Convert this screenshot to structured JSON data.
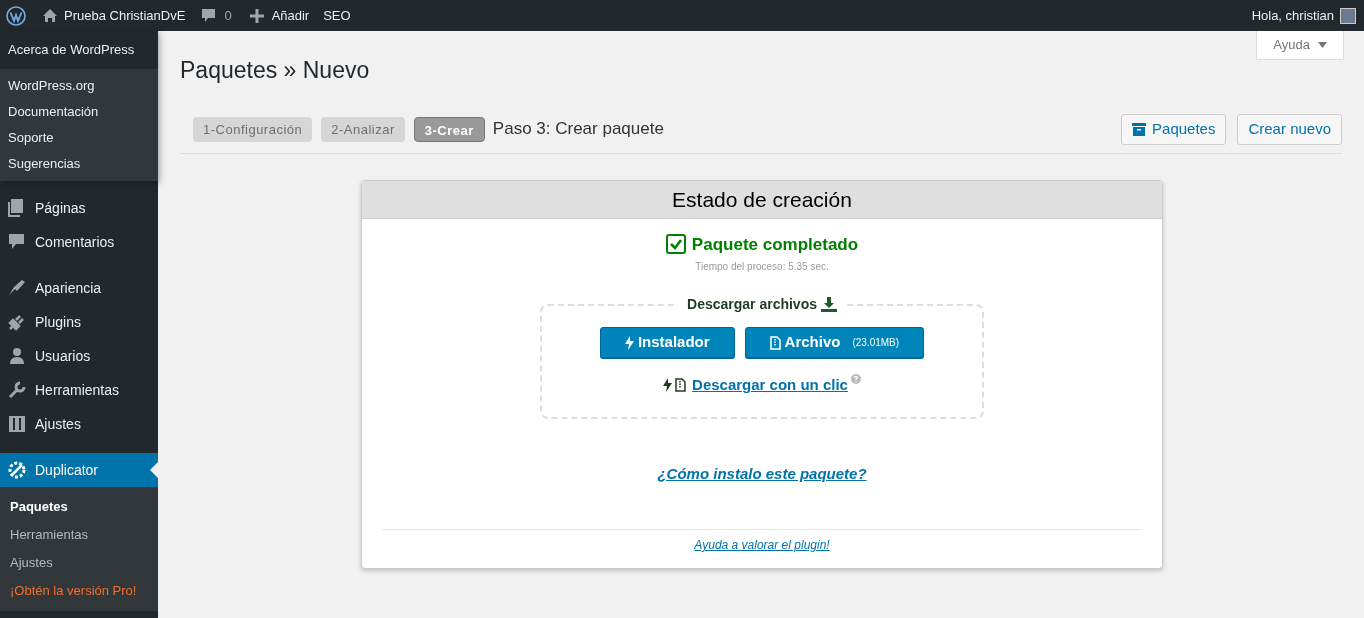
{
  "admin_bar": {
    "site": "Prueba ChristianDvE",
    "comments": "0",
    "add": "Añadir",
    "seo": "SEO",
    "greeting": "Hola, christian"
  },
  "wp_menu": {
    "about": "Acerca de WordPress",
    "links": [
      "WordPress.org",
      "Documentación",
      "Soporte",
      "Sugerencias"
    ]
  },
  "sidebar": {
    "groups": [
      {
        "items": [
          {
            "label": "Páginas",
            "selected": false
          },
          {
            "label": "Comentarios",
            "selected": false
          }
        ]
      },
      {
        "items": [
          {
            "label": "Apariencia",
            "selected": false
          },
          {
            "label": "Plugins",
            "selected": false
          },
          {
            "label": "Usuarios",
            "selected": false
          },
          {
            "label": "Herramientas",
            "selected": false
          },
          {
            "label": "Ajustes",
            "selected": false
          }
        ]
      },
      {
        "items": [
          {
            "label": "Duplicator",
            "selected": true,
            "children": [
              {
                "label": "Paquetes",
                "selected": true,
                "kind": "link"
              },
              {
                "label": "Herramientas",
                "selected": false,
                "kind": "link"
              },
              {
                "label": "Ajustes",
                "selected": false,
                "kind": "link"
              },
              {
                "label": "¡Obtén la versión Pro!",
                "selected": false,
                "kind": "promo"
              }
            ]
          }
        ]
      }
    ]
  },
  "help_button": "Ayuda",
  "page_title": "Paquetes » Nuevo",
  "steps": [
    {
      "label": "1-Configuración",
      "selected": false
    },
    {
      "label": "2-Analizar",
      "selected": false
    },
    {
      "label": "3-Crear",
      "selected": true
    }
  ],
  "step_caption": "Paso 3: Crear paquete",
  "header_buttons": [
    {
      "label": "Paquetes",
      "kind": "icon"
    },
    {
      "label": "Crear nuevo",
      "kind": "plain"
    }
  ],
  "card": {
    "title": "Estado de creación",
    "status": "Paquete completado",
    "time": "Tiempo del proceso: 5.35 sec.",
    "download_legend": "Descargar archivos",
    "downloads": [
      {
        "label": "Instalador",
        "kind": "installer"
      },
      {
        "label": "Archivo",
        "kind": "archive",
        "note": "(23.01MB)"
      }
    ],
    "one_click": "Descargar con un clic",
    "how_to": "¿Cómo instalo este paquete?",
    "rate": "Ayuda a valorar el plugin!"
  }
}
